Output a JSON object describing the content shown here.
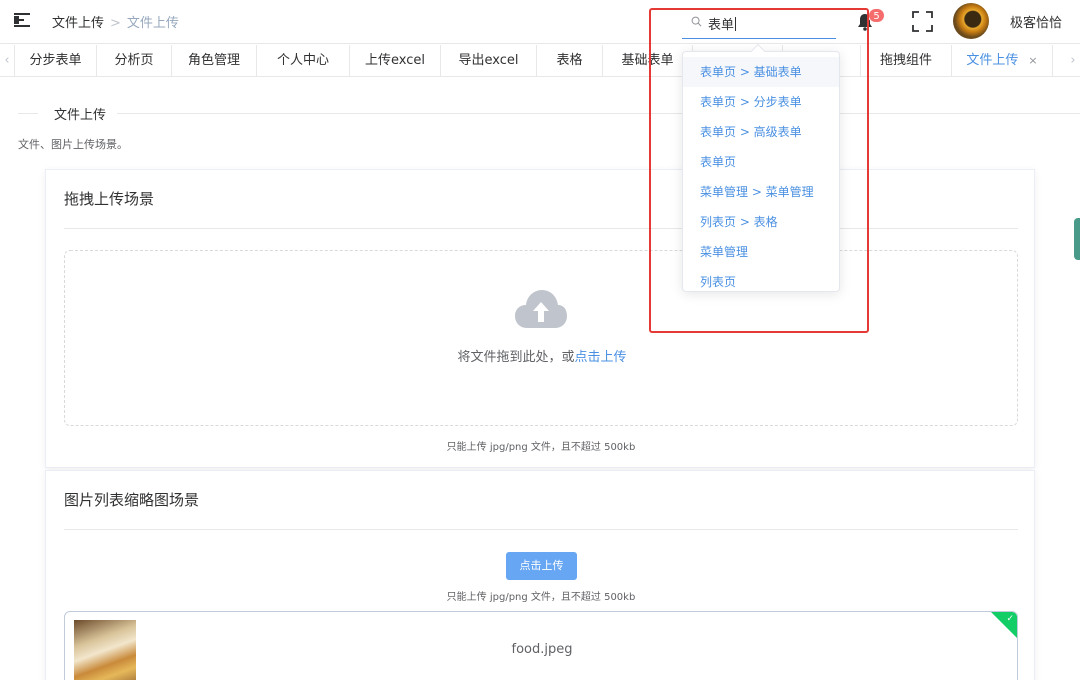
{
  "header": {
    "breadcrumb": [
      "文件上传",
      "文件上传"
    ],
    "search": {
      "value": "表单"
    },
    "notifications": {
      "count": "5"
    },
    "user": {
      "name": "极客恰恰"
    }
  },
  "tags_bar": {
    "tabs": [
      {
        "label": "分步表单",
        "active": false
      },
      {
        "label": "分析页",
        "active": false
      },
      {
        "label": "角色管理",
        "active": false
      },
      {
        "label": "个人中心",
        "active": false
      },
      {
        "label": "上传excel",
        "active": false
      },
      {
        "label": "导出excel",
        "active": false
      },
      {
        "label": "表格",
        "active": false
      },
      {
        "label": "基础表单",
        "active": false
      },
      {
        "label": "拖拽组件",
        "active": false
      },
      {
        "label": "文件上传",
        "active": true
      }
    ],
    "close_symbol": "×"
  },
  "search_suggestions": [
    "表单页 > 基础表单",
    "表单页 > 分步表单",
    "表单页 > 高级表单",
    "表单页",
    "菜单管理 > 菜单管理",
    "列表页 > 表格",
    "菜单管理",
    "列表页"
  ],
  "page": {
    "title": "文件上传",
    "description": "文件、图片上传场景。"
  },
  "drag_upload_card": {
    "title": "拖拽上传场景",
    "dropzone_text": "将文件拖到此处，或",
    "dropzone_link": "点击上传",
    "tip": "只能上传 jpg/png 文件，且不超过 500kb"
  },
  "thumbnail_card": {
    "title": "图片列表缩略图场景",
    "upload_button": "点击上传",
    "tip": "只能上传 jpg/png 文件，且不超过 500kb",
    "files": [
      {
        "name": "food.jpeg",
        "status": "success"
      }
    ]
  },
  "colors": {
    "accent": "#4a90e2",
    "upload_button": "#66a6f2",
    "badge": "#f56c6c",
    "success": "#13ce66",
    "annotation": "#e53935"
  }
}
